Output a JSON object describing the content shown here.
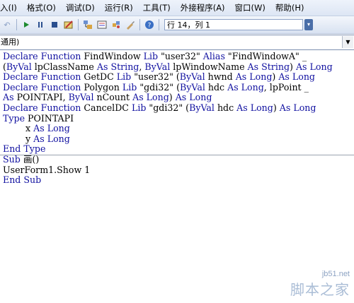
{
  "menubar": {
    "items": [
      "入(I)",
      "格式(O)",
      "调试(D)",
      "运行(R)",
      "工具(T)",
      "外接程序(A)",
      "窗口(W)",
      "帮助(H)"
    ]
  },
  "toolbar": {
    "position_text": "行 14，列 1",
    "icons": [
      "undo-icon",
      "run-icon",
      "pause-icon",
      "reset-icon",
      "design-mode-icon",
      "project-explorer-icon",
      "properties-icon",
      "object-browser-icon",
      "toolbox-icon",
      "help-icon"
    ]
  },
  "object_dropdown": {
    "value": "通用)"
  },
  "code": {
    "lines": [
      [
        {
          "k": "kw",
          "t": "Declare Function"
        },
        {
          "k": "tx",
          "t": " FindWindow "
        },
        {
          "k": "kw",
          "t": "Lib"
        },
        {
          "k": "tx",
          "t": " \"user32\" "
        },
        {
          "k": "kw",
          "t": "Alias"
        },
        {
          "k": "tx",
          "t": " \"FindWindowA\" _"
        }
      ],
      [
        {
          "k": "tx",
          "t": "("
        },
        {
          "k": "kw",
          "t": "ByVal"
        },
        {
          "k": "tx",
          "t": " lpClassName "
        },
        {
          "k": "kw",
          "t": "As String"
        },
        {
          "k": "tx",
          "t": ", "
        },
        {
          "k": "kw",
          "t": "ByVal"
        },
        {
          "k": "tx",
          "t": " lpWindowName "
        },
        {
          "k": "kw",
          "t": "As String"
        },
        {
          "k": "tx",
          "t": ") "
        },
        {
          "k": "kw",
          "t": "As Long"
        }
      ],
      [
        {
          "k": "kw",
          "t": "Declare Function"
        },
        {
          "k": "tx",
          "t": " GetDC "
        },
        {
          "k": "kw",
          "t": "Lib"
        },
        {
          "k": "tx",
          "t": " \"user32\" ("
        },
        {
          "k": "kw",
          "t": "ByVal"
        },
        {
          "k": "tx",
          "t": " hwnd "
        },
        {
          "k": "kw",
          "t": "As Long"
        },
        {
          "k": "tx",
          "t": ") "
        },
        {
          "k": "kw",
          "t": "As Long"
        }
      ],
      [
        {
          "k": "kw",
          "t": "Declare Function"
        },
        {
          "k": "tx",
          "t": " Polygon "
        },
        {
          "k": "kw",
          "t": "Lib"
        },
        {
          "k": "tx",
          "t": " \"gdi32\" ("
        },
        {
          "k": "kw",
          "t": "ByVal"
        },
        {
          "k": "tx",
          "t": " hdc "
        },
        {
          "k": "kw",
          "t": "As Long"
        },
        {
          "k": "tx",
          "t": ", lpPoint _"
        }
      ],
      [
        {
          "k": "kw",
          "t": "As"
        },
        {
          "k": "tx",
          "t": " POINTAPI, "
        },
        {
          "k": "kw",
          "t": "ByVal"
        },
        {
          "k": "tx",
          "t": " nCount "
        },
        {
          "k": "kw",
          "t": "As Long"
        },
        {
          "k": "tx",
          "t": ") "
        },
        {
          "k": "kw",
          "t": "As Long"
        }
      ],
      [
        {
          "k": "kw",
          "t": "Declare Function"
        },
        {
          "k": "tx",
          "t": " CancelDC "
        },
        {
          "k": "kw",
          "t": "Lib"
        },
        {
          "k": "tx",
          "t": " \"gdi32\" ("
        },
        {
          "k": "kw",
          "t": "ByVal"
        },
        {
          "k": "tx",
          "t": " hdc "
        },
        {
          "k": "kw",
          "t": "As Long"
        },
        {
          "k": "tx",
          "t": ") "
        },
        {
          "k": "kw",
          "t": "As Long"
        }
      ],
      [
        {
          "k": "kw",
          "t": "Type"
        },
        {
          "k": "tx",
          "t": " POINTAPI"
        }
      ],
      [
        {
          "k": "tx",
          "t": "        x "
        },
        {
          "k": "kw",
          "t": "As Long"
        }
      ],
      [
        {
          "k": "tx",
          "t": "        y "
        },
        {
          "k": "kw",
          "t": "As Long"
        }
      ],
      [
        {
          "k": "kw",
          "t": "End Type"
        }
      ],
      [
        {
          "k": "kw",
          "t": "Sub"
        },
        {
          "k": "tx",
          "t": " 画()"
        }
      ],
      [
        {
          "k": "tx",
          "t": "UserForm1.Show 1"
        }
      ],
      [
        {
          "k": "kw",
          "t": "End Sub"
        }
      ]
    ]
  },
  "watermark": {
    "url": "jb51.net",
    "name": "脚本之家"
  }
}
